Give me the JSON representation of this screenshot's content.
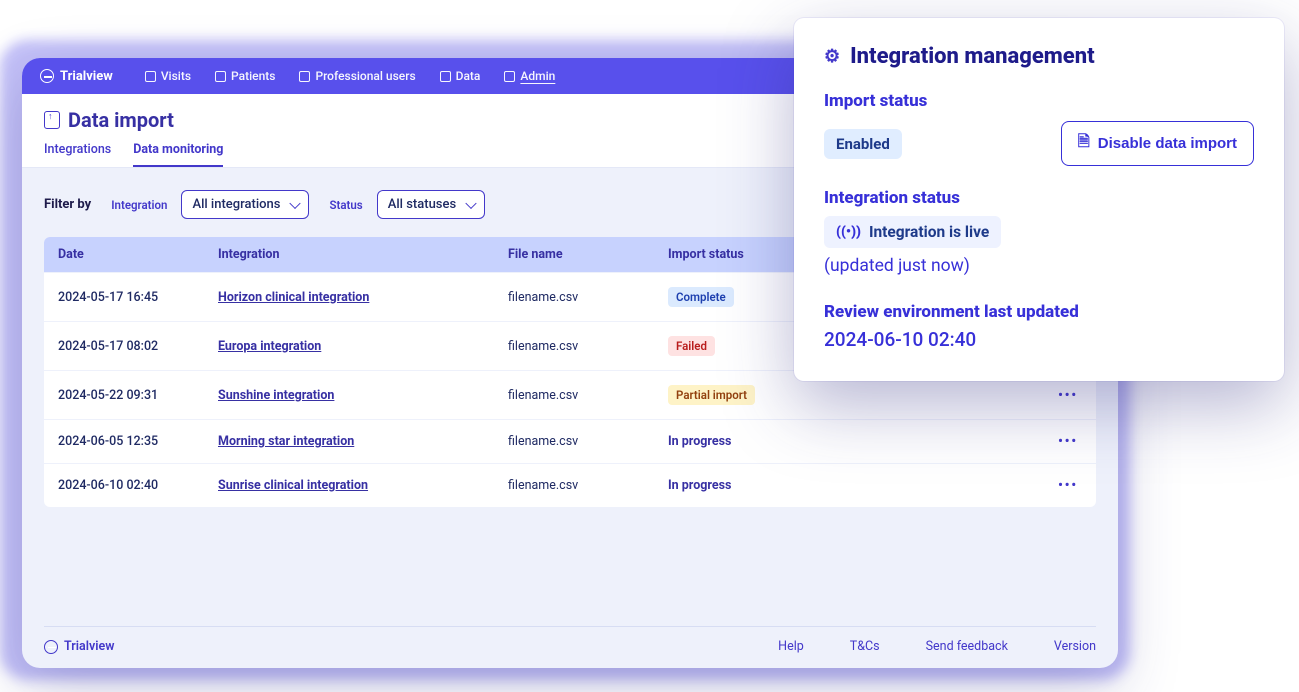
{
  "brand": "Trialview",
  "nav": {
    "items": [
      {
        "label": "Visits"
      },
      {
        "label": "Patients"
      },
      {
        "label": "Professional users"
      },
      {
        "label": "Data"
      },
      {
        "label": "Admin"
      }
    ],
    "active": "Admin"
  },
  "page": {
    "title": "Data import",
    "tabs": [
      {
        "label": "Integrations"
      },
      {
        "label": "Data monitoring"
      }
    ],
    "active_tab": "Data monitoring"
  },
  "filters": {
    "label": "Filter by",
    "integration_label": "Integration",
    "integration_value": "All integrations",
    "status_label": "Status",
    "status_value": "All statuses"
  },
  "table": {
    "columns": [
      "Date",
      "Integration",
      "File name",
      "Import status"
    ],
    "rows": [
      {
        "date": "2024-05-17 16:45",
        "integration": "Horizon clinical integration",
        "file": "filename.csv",
        "status": "Complete",
        "status_type": "complete"
      },
      {
        "date": "2024-05-17 08:02",
        "integration": "Europa integration",
        "file": "filename.csv",
        "status": "Failed",
        "status_type": "failed"
      },
      {
        "date": "2024-05-22 09:31",
        "integration": "Sunshine integration",
        "file": "filename.csv",
        "status": "Partial import",
        "status_type": "partial"
      },
      {
        "date": "2024-06-05 12:35",
        "integration": "Morning star integration",
        "file": "filename.csv",
        "status": "In progress",
        "status_type": "inprogress"
      },
      {
        "date": "2024-06-10 02:40",
        "integration": "Sunrise clinical integration",
        "file": "filename.csv",
        "status": "In progress",
        "status_type": "inprogress"
      }
    ]
  },
  "footer": {
    "brand": "Trialview",
    "links": [
      "Help",
      "T&Cs",
      "Send feedback",
      "Version"
    ]
  },
  "panel": {
    "title": "Integration management",
    "import_status_label": "Import status",
    "import_status_value": "Enabled",
    "disable_button": "Disable data import",
    "integration_status_label": "Integration status",
    "integration_status_value": "Integration is live",
    "updated_text": "(updated just now)",
    "review_label": "Review environment last updated",
    "review_value": "2024-06-10 02:40"
  }
}
